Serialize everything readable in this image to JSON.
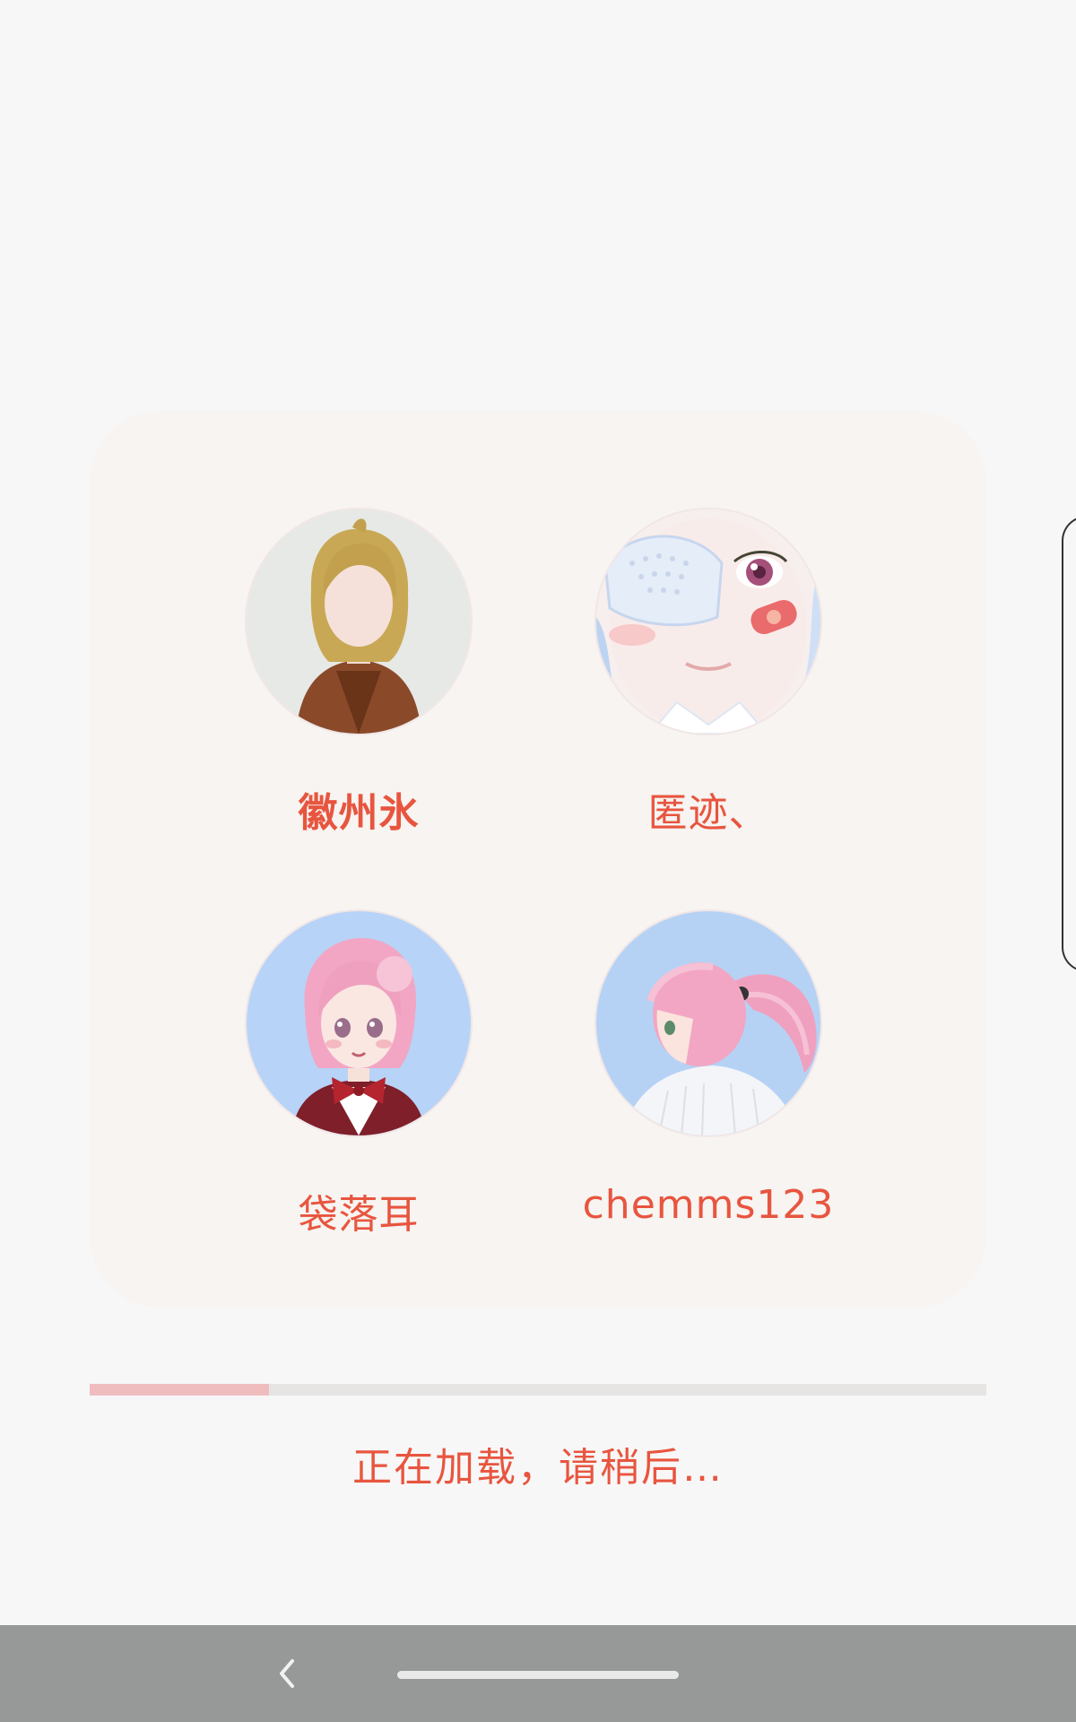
{
  "users": [
    {
      "name": "徽州氷",
      "avatar_icon": "avatar-blonde-girl-brown-jacket",
      "selected": true
    },
    {
      "name": "匿迹、",
      "avatar_icon": "avatar-eyepatch-closeup",
      "selected": false
    },
    {
      "name": "袋落耳",
      "avatar_icon": "avatar-pink-hair-red-bow",
      "selected": false
    },
    {
      "name": "chemms123",
      "avatar_icon": "avatar-pink-ponytail-back",
      "selected": false
    }
  ],
  "progress": {
    "value_percent": 20
  },
  "loading_text": "正在加载，请稍后…",
  "colors": {
    "accent_text": "#e8553f",
    "progress_fill": "#f0bdbf",
    "progress_track": "#e7e4e4",
    "card_bg": "#f7f4f1",
    "navbar_bg": "#979998"
  },
  "navbar": {
    "back_icon": "chevron-left-icon",
    "home_icon": "home-bar-icon"
  }
}
